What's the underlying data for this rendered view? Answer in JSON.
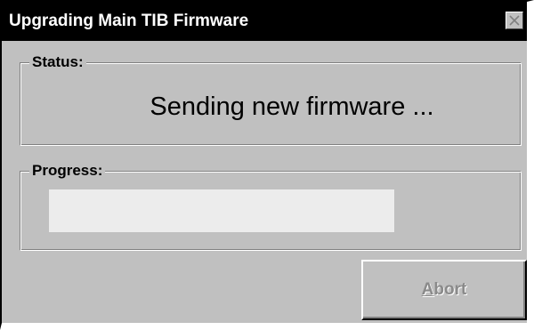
{
  "window": {
    "title": "Upgrading Main TIB Firmware",
    "close_icon": "close-icon"
  },
  "status": {
    "label": "Status:",
    "message": "Sending new firmware ..."
  },
  "progress": {
    "label": "Progress:",
    "value_percent": 0
  },
  "abort_button": {
    "accelerator": "A",
    "rest": "bort",
    "enabled": false
  },
  "colors": {
    "titlebar": "#000000",
    "face": "#c0c0c0",
    "progress_track": "#ececec",
    "disabled_text": "#8a8a8a"
  }
}
